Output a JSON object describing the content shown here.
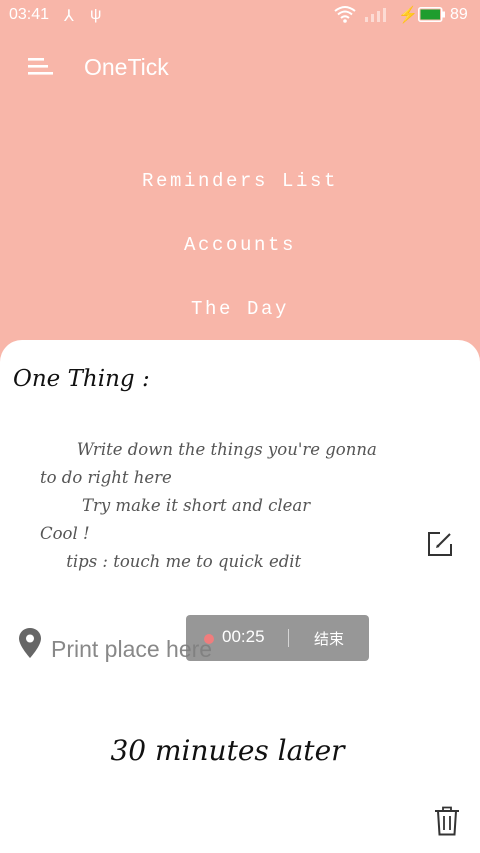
{
  "status_bar": {
    "time": "03:41",
    "usb_symbol_1": "⅄",
    "usb_symbol_2": "ψ",
    "charging_symbol": "⚡",
    "battery_level": "89",
    "battery_color": "#1f9d2e",
    "icons": [
      "usb-icon",
      "usb-icon",
      "wifi-icon",
      "signal-icon",
      "charging-icon",
      "battery-icon"
    ]
  },
  "app_bar": {
    "menu_icon": "menu-icon",
    "title": "OneTick"
  },
  "nav": {
    "items": [
      {
        "label": "Reminders List"
      },
      {
        "label": "Accounts"
      },
      {
        "label": "The Day"
      }
    ]
  },
  "card": {
    "heading": "One Thing :",
    "body": "       Write down the things you're gonna\nto do right here\n        Try make it short and clear\nCool !\n     tips : touch me to quick edit",
    "edit_icon": "edit-icon",
    "location_icon": "location-pin-icon",
    "place_placeholder": "Print place here",
    "timer_text": "30 minutes later",
    "delete_icon": "trash-icon"
  },
  "recording_overlay": {
    "elapsed": "00:25",
    "end_label": "结束",
    "dot_color": "#f07d7d"
  },
  "colors": {
    "background": "#f8b6a9",
    "card": "#ffffff",
    "header_text": "#ffffff"
  }
}
